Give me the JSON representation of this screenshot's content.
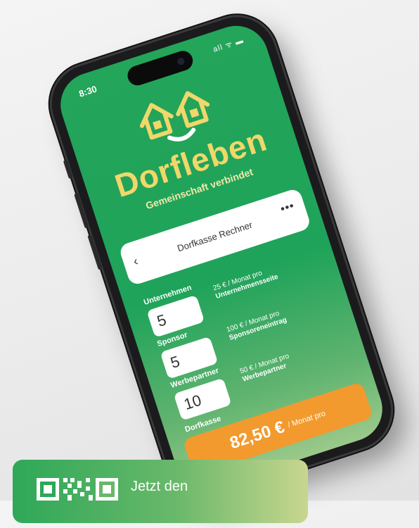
{
  "status_bar": {
    "time": "8:30",
    "indicators": "all ᯤ ▬"
  },
  "brand": {
    "name": "Dorfleben",
    "tagline": "Gemeinschaft verbindet"
  },
  "calculator": {
    "title": "Dorfkasse Rechner",
    "back_icon": "‹",
    "more_icon": "•••",
    "rows": [
      {
        "label": "Unternehmen",
        "value": "5",
        "price": "25 €",
        "unit": "/ Monat pro",
        "desc": "Unternehmensseite"
      },
      {
        "label": "Sponsor",
        "value": "5",
        "price": "100 €",
        "unit": "/ Monat pro",
        "desc": "Sponsoreneintrag"
      },
      {
        "label": "Werbepartner",
        "value": "10",
        "price": "50 €",
        "unit": "/ Monat pro",
        "desc": "Werbepartner"
      }
    ],
    "total_label": "Dorfkasse",
    "total_value": "82,50 €",
    "total_unit": "/ Monat pro"
  },
  "cta": {
    "text": "Jetzt den"
  },
  "colors": {
    "primary_green": "#23a55a",
    "accent_orange": "#f29a2e",
    "brand_yellow": "#f1d76a"
  },
  "icons": [
    "houses-logo-icon",
    "back-chevron-icon",
    "more-dots-icon",
    "qr-code-icon"
  ]
}
